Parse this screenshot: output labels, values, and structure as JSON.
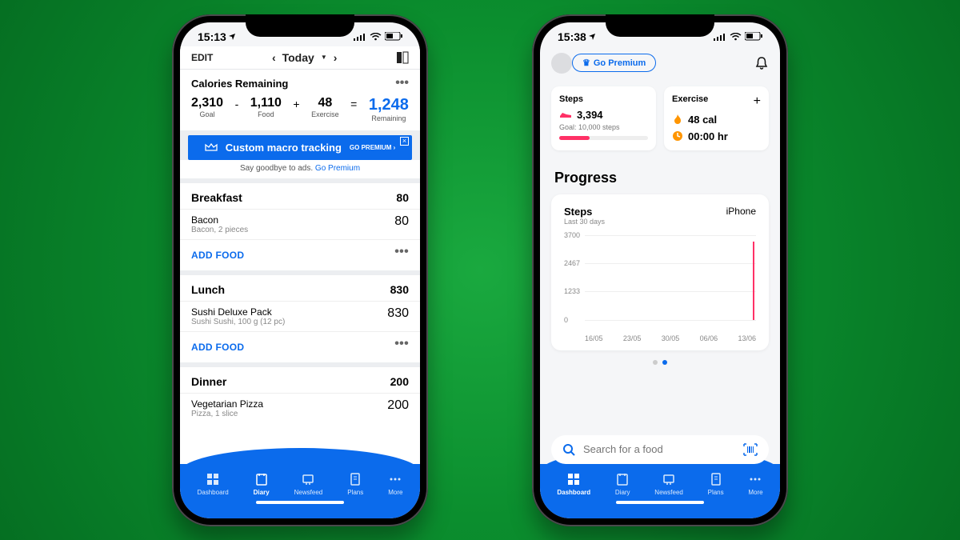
{
  "left": {
    "status": {
      "time": "15:13",
      "signal": "•ıll",
      "wifi": "wifi",
      "battery": "batt"
    },
    "topbar": {
      "edit": "EDIT",
      "date_label": "Today"
    },
    "calories": {
      "title": "Calories Remaining",
      "goal": "2,310",
      "goal_label": "Goal",
      "food": "1,110",
      "food_label": "Food",
      "exercise": "48",
      "exercise_label": "Exercise",
      "remaining": "1,248",
      "remaining_label": "Remaining",
      "minus": "-",
      "plus": "+",
      "equals": "="
    },
    "ad": {
      "title": "Custom macro tracking",
      "cta": "GO PREMIUM ›"
    },
    "ad_sub": {
      "text": "Say goodbye to ads.",
      "link": "Go Premium"
    },
    "meals": [
      {
        "name": "Breakfast",
        "total": "80",
        "items": [
          {
            "name": "Bacon",
            "sub": "Bacon, 2 pieces",
            "cal": "80"
          }
        ],
        "add": "ADD FOOD"
      },
      {
        "name": "Lunch",
        "total": "830",
        "items": [
          {
            "name": "Sushi Deluxe Pack",
            "sub": "Sushi Sushi, 100 g (12 pc)",
            "cal": "830"
          }
        ],
        "add": "ADD FOOD"
      },
      {
        "name": "Dinner",
        "total": "200",
        "items": [
          {
            "name": "Vegetarian Pizza",
            "sub": "Pizza, 1 slice",
            "cal": "200"
          }
        ]
      }
    ],
    "nav": [
      "Dashboard",
      "Diary",
      "Newsfeed",
      "Plans",
      "More"
    ],
    "nav_active": 1
  },
  "right": {
    "status": {
      "time": "15:38"
    },
    "go_premium": "Go Premium",
    "steps_card": {
      "title": "Steps",
      "value": "3,394",
      "goal": "Goal: 10,000 steps",
      "progress_pct": 34
    },
    "exercise_card": {
      "title": "Exercise",
      "cal": "48 cal",
      "time": "00:00 hr"
    },
    "progress_title": "Progress",
    "chart": {
      "title": "Steps",
      "sub": "Last 30 days",
      "source": "iPhone"
    },
    "search_placeholder": "Search for a food",
    "nav": [
      "Dashboard",
      "Diary",
      "Newsfeed",
      "Plans",
      "More"
    ],
    "nav_active": 0
  },
  "chart_data": {
    "type": "line",
    "title": "Steps",
    "subtitle": "Last 30 days",
    "source": "iPhone",
    "xlabel": "date",
    "ylabel": "steps",
    "ylim": [
      0,
      3700
    ],
    "y_ticks": [
      0,
      1233,
      2467,
      3700
    ],
    "x_ticks": [
      "16/05",
      "23/05",
      "30/05",
      "06/06",
      "13/06"
    ],
    "series": [
      {
        "name": "Steps",
        "x": [
          "16/05",
          "23/05",
          "30/05",
          "06/06",
          "12/06",
          "13/06"
        ],
        "values": [
          0,
          0,
          0,
          0,
          0,
          3394
        ]
      }
    ]
  }
}
